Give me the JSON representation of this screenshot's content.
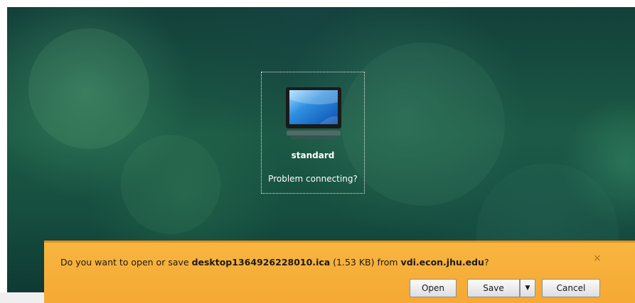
{
  "desktop": {
    "app_name": "standard",
    "connection_help_link": "Problem connecting?",
    "app_icon": "monitor-icon"
  },
  "download_bar": {
    "message_prefix": "Do you want to open or save ",
    "file_name": "desktop1364926228010.ica",
    "file_size": " (1.53 KB) from ",
    "source_host": "vdi.econ.jhu.edu",
    "message_suffix": "?",
    "close_icon": "close-icon",
    "open_label": "Open",
    "save_label": "Save",
    "save_dropdown_glyph": "▼",
    "cancel_label": "Cancel",
    "close_glyph": "×",
    "bar_color": "#f7b53f"
  }
}
